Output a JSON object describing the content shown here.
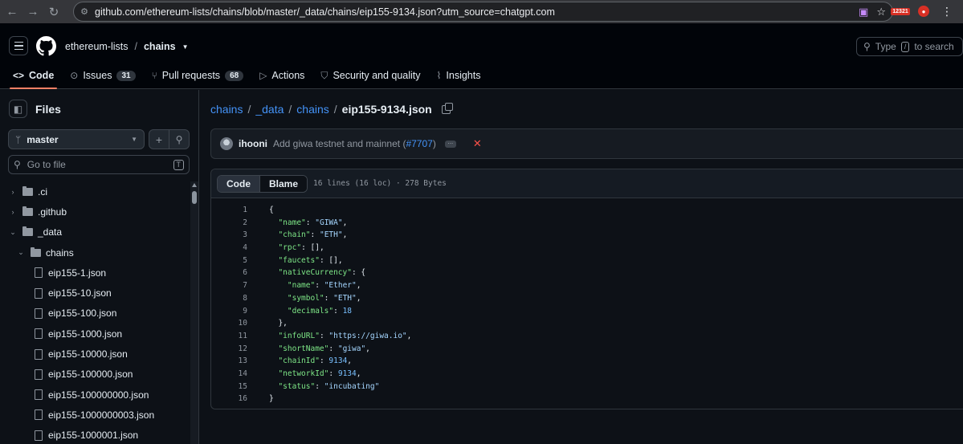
{
  "browser": {
    "url": "github.com/ethereum-lists/chains/blob/master/_data/chains/eip155-9134.json?utm_source=chatgpt.com",
    "extension_badge": "12321"
  },
  "header": {
    "owner": "ethereum-lists",
    "separator": "/",
    "repo": "chains",
    "search_prefix": "Type",
    "search_key": "/",
    "search_suffix": "to search"
  },
  "tabs": [
    {
      "label": "Code",
      "icon": "code-icon"
    },
    {
      "label": "Issues",
      "count": "31",
      "icon": "issue-icon"
    },
    {
      "label": "Pull requests",
      "count": "68",
      "icon": "pull-request-icon"
    },
    {
      "label": "Actions",
      "icon": "play-icon"
    },
    {
      "label": "Security and quality",
      "icon": "shield-icon"
    },
    {
      "label": "Insights",
      "icon": "graph-icon"
    }
  ],
  "sidebar": {
    "title": "Files",
    "branch": "master",
    "goto_placeholder": "Go to file",
    "goto_key": "T",
    "tree": [
      {
        "label": ".ci",
        "type": "folder",
        "chev": "›",
        "indent": 0
      },
      {
        "label": ".github",
        "type": "folder",
        "chev": "›",
        "indent": 0
      },
      {
        "label": "_data",
        "type": "folder",
        "chev": "⌄",
        "indent": 0
      },
      {
        "label": "chains",
        "type": "folder",
        "chev": "⌄",
        "indent": 1
      },
      {
        "label": "eip155-1.json",
        "type": "file",
        "indent": 2
      },
      {
        "label": "eip155-10.json",
        "type": "file",
        "indent": 2
      },
      {
        "label": "eip155-100.json",
        "type": "file",
        "indent": 2
      },
      {
        "label": "eip155-1000.json",
        "type": "file",
        "indent": 2
      },
      {
        "label": "eip155-10000.json",
        "type": "file",
        "indent": 2
      },
      {
        "label": "eip155-100000.json",
        "type": "file",
        "indent": 2
      },
      {
        "label": "eip155-100000000.json",
        "type": "file",
        "indent": 2
      },
      {
        "label": "eip155-1000000003.json",
        "type": "file",
        "indent": 2
      },
      {
        "label": "eip155-1000001.json",
        "type": "file",
        "indent": 2
      }
    ]
  },
  "main": {
    "path": [
      "chains",
      "_data",
      "chains"
    ],
    "path_sep": "/",
    "file": "eip155-9134.json",
    "commit": {
      "author": "ihooni",
      "message": "Add giwa testnet and mainnet (",
      "pr": "#7707",
      "message_end": ")",
      "ellipsis": "…",
      "status": "✕"
    },
    "view_code": "Code",
    "view_blame": "Blame",
    "file_meta": "16 lines (16 loc) · 278 Bytes"
  },
  "code_lines": [
    "{",
    "  \"name\": \"GIWA\",",
    "  \"chain\": \"ETH\",",
    "  \"rpc\": [],",
    "  \"faucets\": [],",
    "  \"nativeCurrency\": {",
    "    \"name\": \"Ether\",",
    "    \"symbol\": \"ETH\",",
    "    \"decimals\": 18",
    "  },",
    "  \"infoURL\": \"https://giwa.io\",",
    "  \"shortName\": \"giwa\",",
    "  \"chainId\": 9134,",
    "  \"networkId\": 9134,",
    "  \"status\": \"incubating\"",
    "}"
  ],
  "colors": {
    "accent_link": "#4493f8",
    "active_tab_underline": "#f78166",
    "json_key": "#7ee787",
    "json_string": "#a5d6ff",
    "json_number": "#79c0ff"
  }
}
